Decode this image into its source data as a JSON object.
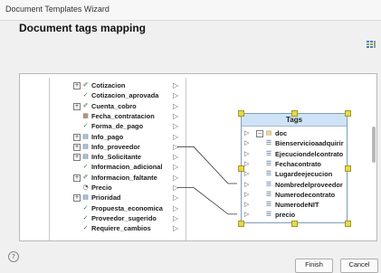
{
  "window": {
    "title": "Document Templates Wizard"
  },
  "page": {
    "heading": "Document tags mapping"
  },
  "tree": {
    "items": [
      {
        "label": "Cotizacion",
        "icon": "attachment-icon",
        "expandable": true
      },
      {
        "label": "Cotizacion_aprovada",
        "icon": "check-icon",
        "expandable": false
      },
      {
        "label": "Cuenta_cobro",
        "icon": "attachment-icon",
        "expandable": true
      },
      {
        "label": "Fecha_contratacion",
        "icon": "calendar-icon",
        "expandable": false
      },
      {
        "label": "Forma_de_pago",
        "icon": "check-icon",
        "expandable": false
      },
      {
        "label": "Info_pago",
        "icon": "table-icon",
        "expandable": true
      },
      {
        "label": "Info_proveedor",
        "icon": "table-icon",
        "expandable": true
      },
      {
        "label": "Info_Solicitante",
        "icon": "table-icon",
        "expandable": true
      },
      {
        "label": "Informacion_adicional",
        "icon": "check-icon",
        "expandable": false
      },
      {
        "label": "Informacion_faltante",
        "icon": "attachment-icon",
        "expandable": true
      },
      {
        "label": "Precio",
        "icon": "clock-icon",
        "expandable": false
      },
      {
        "label": "Prioridad",
        "icon": "list-icon",
        "expandable": true
      },
      {
        "label": "Propuesta_economica",
        "icon": "check-icon",
        "expandable": false
      },
      {
        "label": "Proveedor_sugerido",
        "icon": "check-icon",
        "expandable": false
      },
      {
        "label": "Requiere_cambios",
        "icon": "check-icon",
        "expandable": false
      }
    ]
  },
  "tags": {
    "title": "Tags",
    "root": {
      "label": "doc",
      "icon": "folder-icon"
    },
    "items": [
      {
        "label": "Bienservicioaadquirir"
      },
      {
        "label": "Ejecuciondelcontrato"
      },
      {
        "label": "Fechacontrato"
      },
      {
        "label": "Lugardeejecucion"
      },
      {
        "label": "Nombredelproveedor"
      },
      {
        "label": "Numerodecontrato"
      },
      {
        "label": "NumerodeNIT"
      },
      {
        "label": "precio"
      }
    ]
  },
  "mappings": [
    {
      "from": "Info_proveedor",
      "to": "Nombredelproveedor"
    },
    {
      "from": "Precio",
      "to": "precio"
    }
  ],
  "footer": {
    "finish_label": "Finish",
    "cancel_label": "Cancel"
  }
}
